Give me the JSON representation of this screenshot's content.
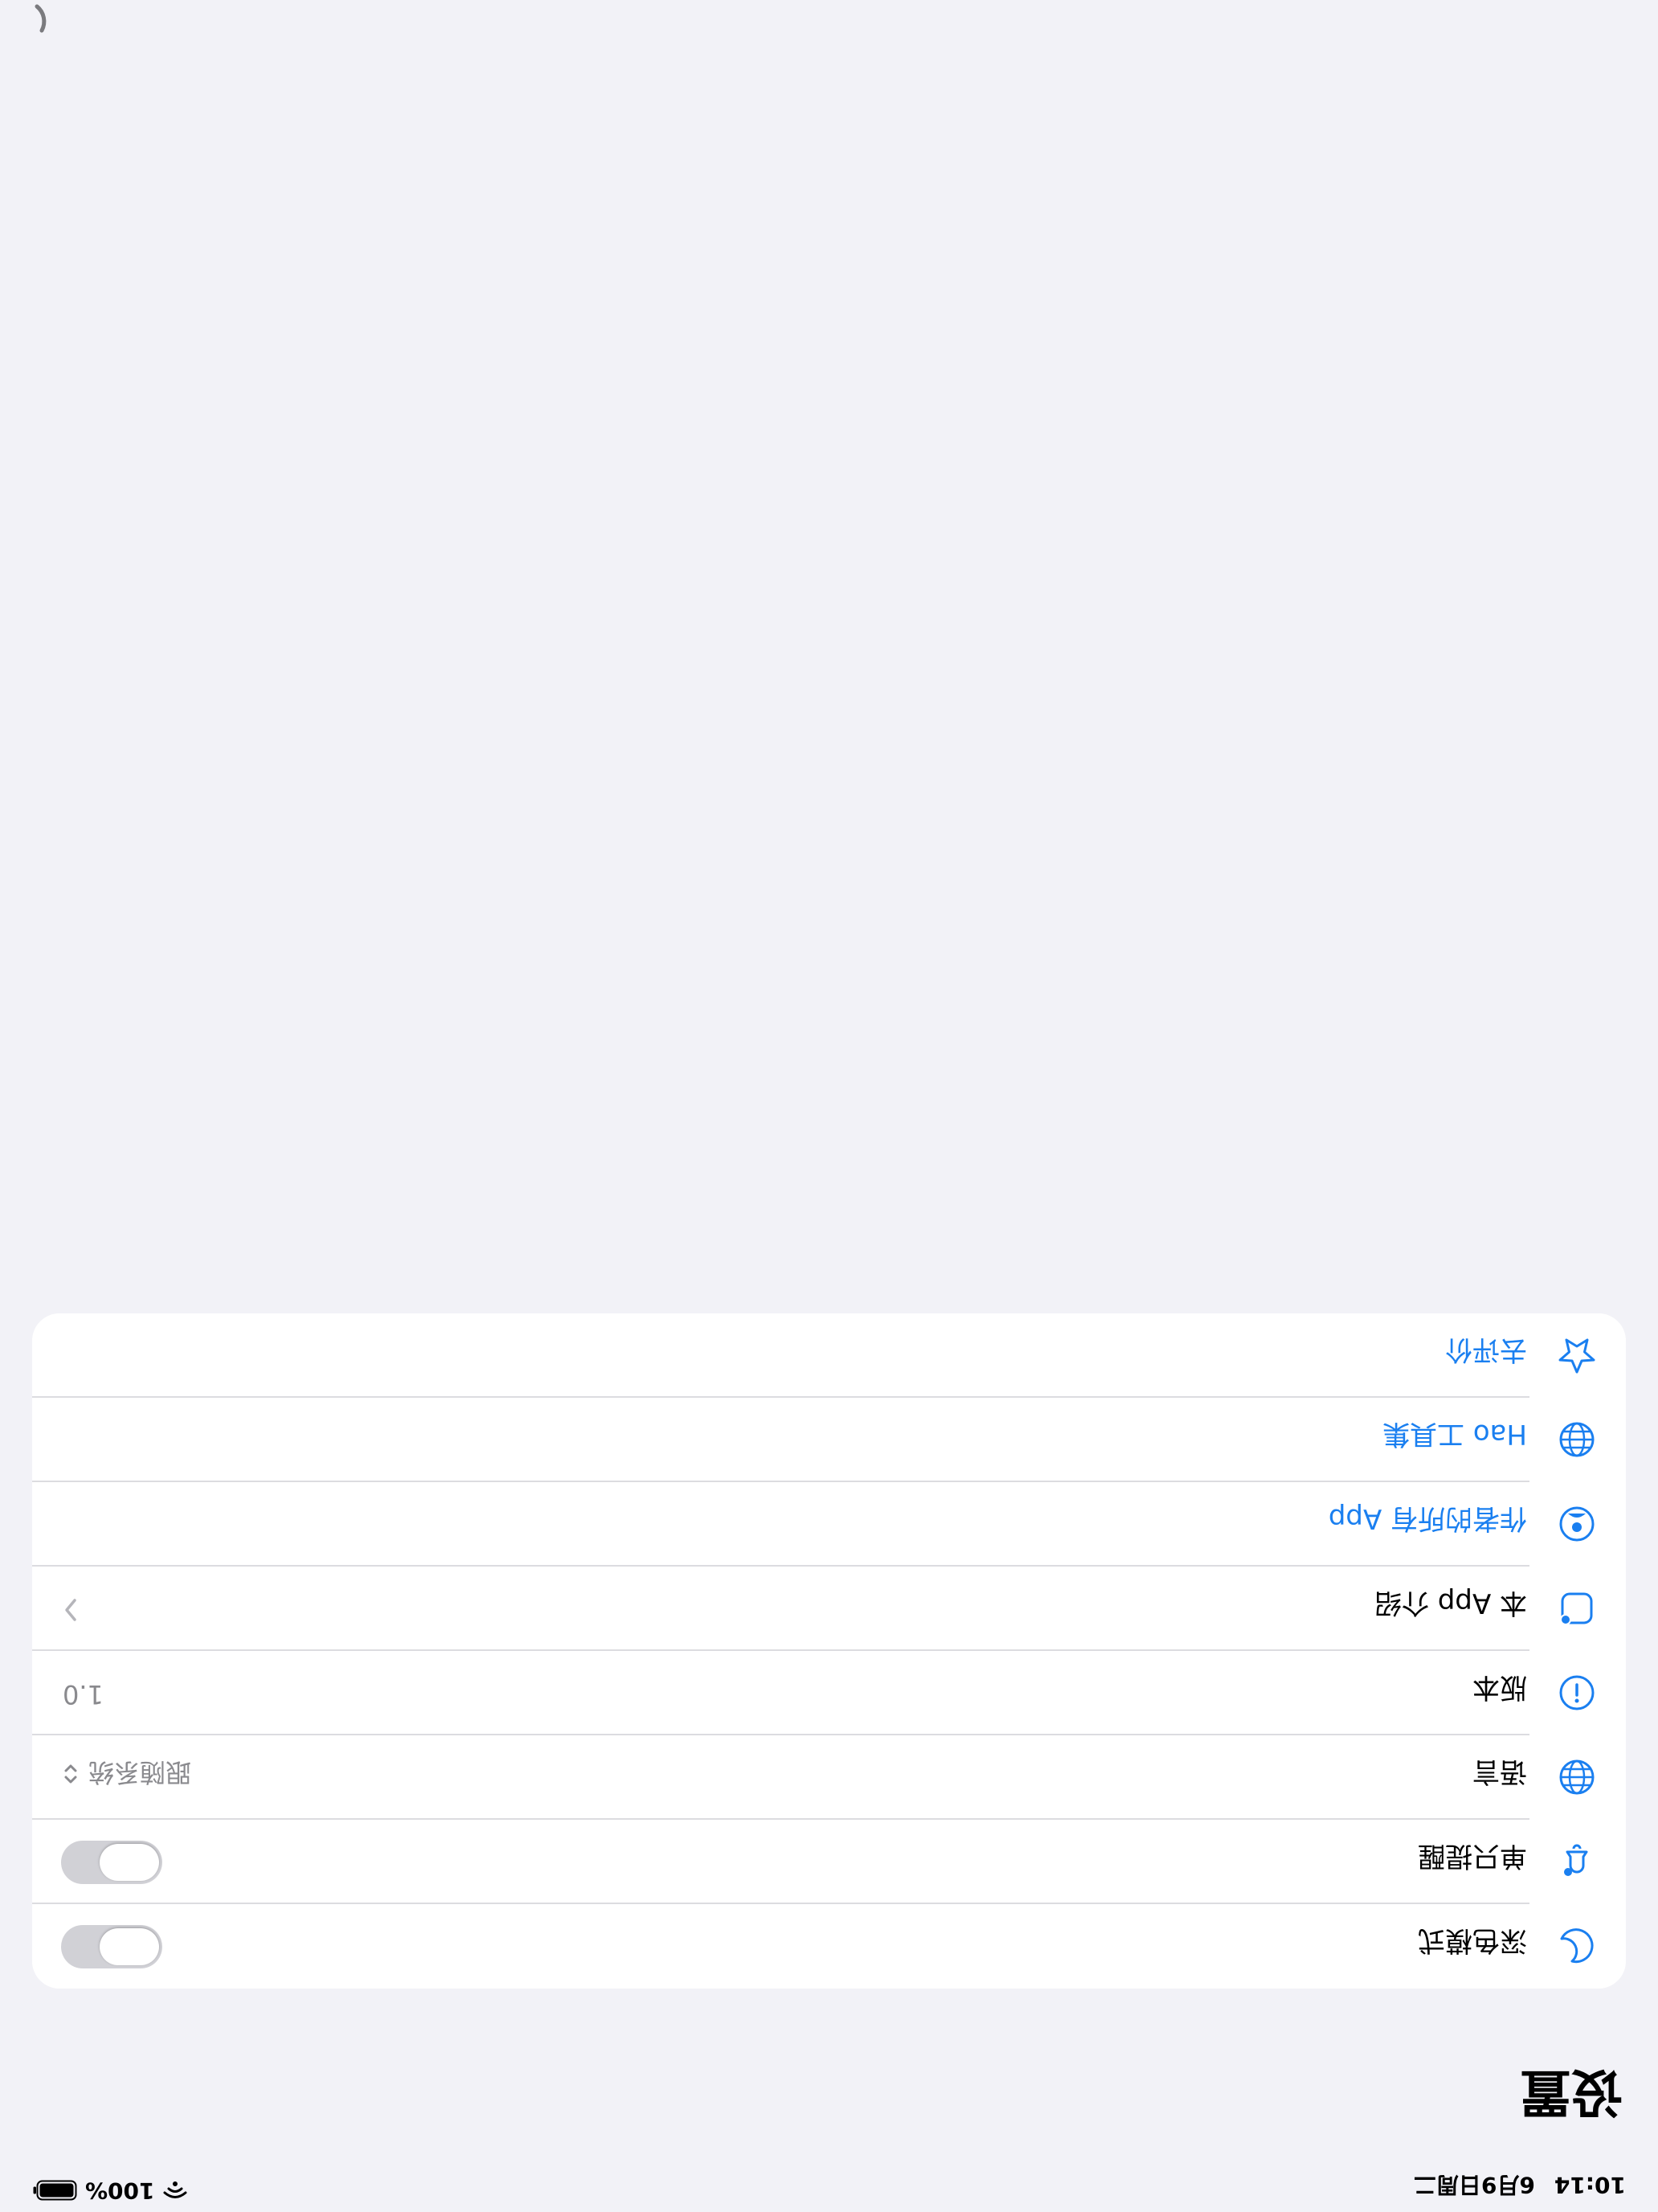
{
  "status_bar": {
    "time": "10:14",
    "date": "6月9日周二",
    "battery_percent": "100%"
  },
  "page": {
    "title": "设置"
  },
  "settings": {
    "dark_mode": {
      "label": "深色模式",
      "icon": "moon-icon",
      "toggle_on": false
    },
    "alert_sound": {
      "label": "单只提醒",
      "icon": "bell-icon",
      "toggle_on": false
    },
    "language": {
      "label": "语言",
      "icon": "globe-icon",
      "value": "跟随系统"
    },
    "version": {
      "label": "版本",
      "icon": "info-icon",
      "value": "1.0"
    },
    "about": {
      "label": "本 App 介绍",
      "icon": "app-intro-icon"
    },
    "author_apps": {
      "label": "作者的所有 App",
      "icon": "person-icon"
    },
    "hao_tools": {
      "label": "Hao 工具集",
      "icon": "globe-icon"
    },
    "rate": {
      "label": "去评价",
      "icon": "star-icon"
    }
  },
  "colors": {
    "accent": "#1a7ff0",
    "background": "#f2f2f7",
    "card": "#ffffff",
    "secondary_text": "#8a8a8e",
    "toggle_off": "#d1d1d6"
  }
}
